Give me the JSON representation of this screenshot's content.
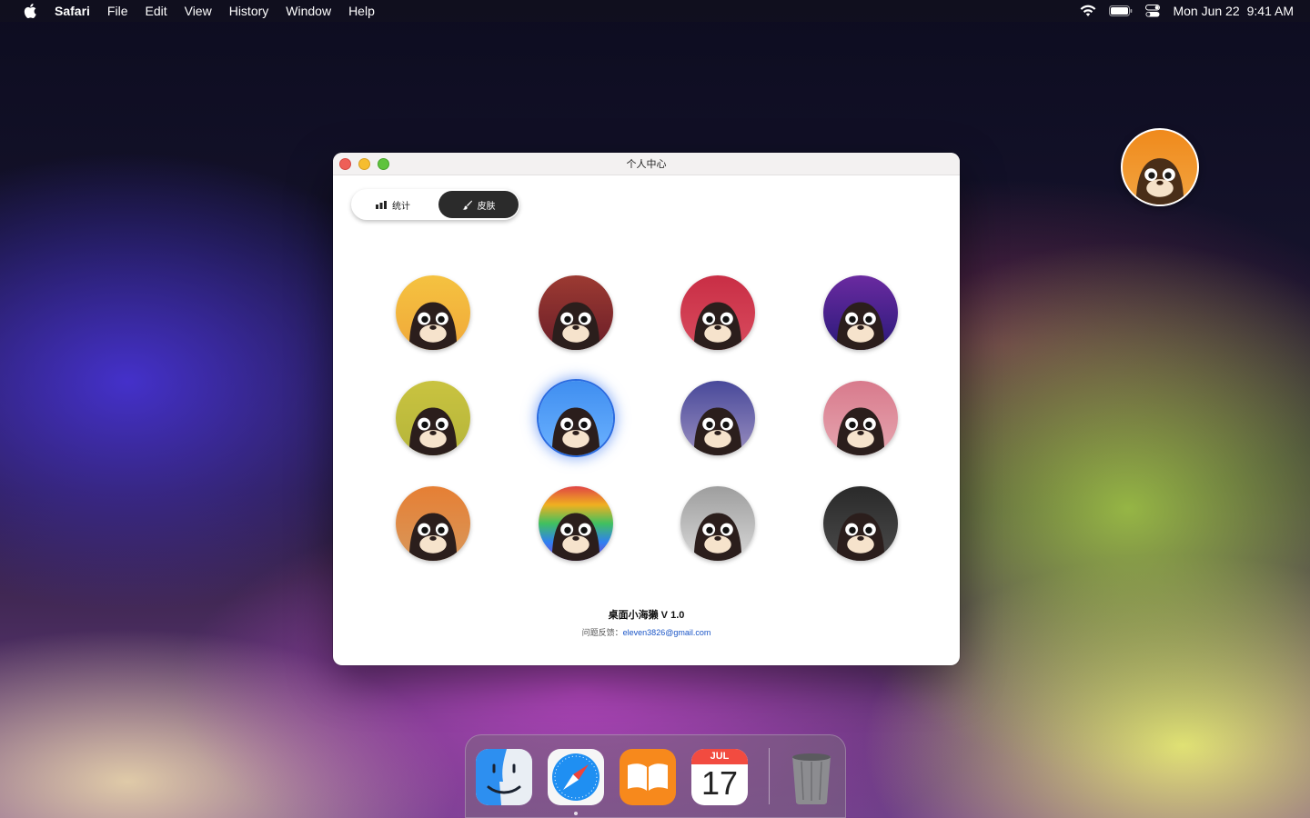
{
  "menubar": {
    "app_name": "Safari",
    "items": [
      "File",
      "Edit",
      "View",
      "History",
      "Window",
      "Help"
    ],
    "date": "Mon Jun 22",
    "time": "9:41 AM"
  },
  "window": {
    "title": "个人中心",
    "tabs": [
      {
        "label": "统计",
        "icon": "bar-chart-icon",
        "active": false
      },
      {
        "label": "皮肤",
        "icon": "paintbrush-icon",
        "active": true
      }
    ],
    "skins": [
      {
        "id": "yellow",
        "colors": [
          "#f5c240",
          "#f0a93a"
        ]
      },
      {
        "id": "maroon",
        "colors": [
          "#9c3a32",
          "#6b1e28"
        ]
      },
      {
        "id": "crimson",
        "colors": [
          "#c92e45",
          "#d84b5e"
        ]
      },
      {
        "id": "indigo",
        "colors": [
          "#6a2aa0",
          "#2a1a7a"
        ]
      },
      {
        "id": "olive",
        "colors": [
          "#c9c340",
          "#b5b53a"
        ]
      },
      {
        "id": "blue",
        "colors": [
          "#3f8ef0",
          "#6cb2ff"
        ],
        "selected": true
      },
      {
        "id": "navy",
        "colors": [
          "#48499a",
          "#9a8fc0"
        ]
      },
      {
        "id": "rose",
        "colors": [
          "#d87a8c",
          "#e6a6b0"
        ]
      },
      {
        "id": "orange",
        "colors": [
          "#e67f34",
          "#d8975a"
        ]
      },
      {
        "id": "rainbow",
        "colors": [
          "#e04444",
          "#f0b020",
          "#40c060",
          "#3080f0",
          "#8040d0"
        ]
      },
      {
        "id": "gray",
        "colors": [
          "#9e9e9e",
          "#d8d8d8"
        ]
      },
      {
        "id": "black",
        "colors": [
          "#2a2a2a",
          "#4a4a4a"
        ]
      }
    ],
    "footer": {
      "app_version": "桌面小海獭  V 1.0",
      "feedback_label": "问题反馈：",
      "feedback_email": "eleven3826@gmail.com"
    }
  },
  "calendar": {
    "month": "JUL",
    "day": "17"
  },
  "colors": {
    "accent": "#2a6be0",
    "link": "#1a55c7",
    "segment_active": "#2b2b2b"
  }
}
